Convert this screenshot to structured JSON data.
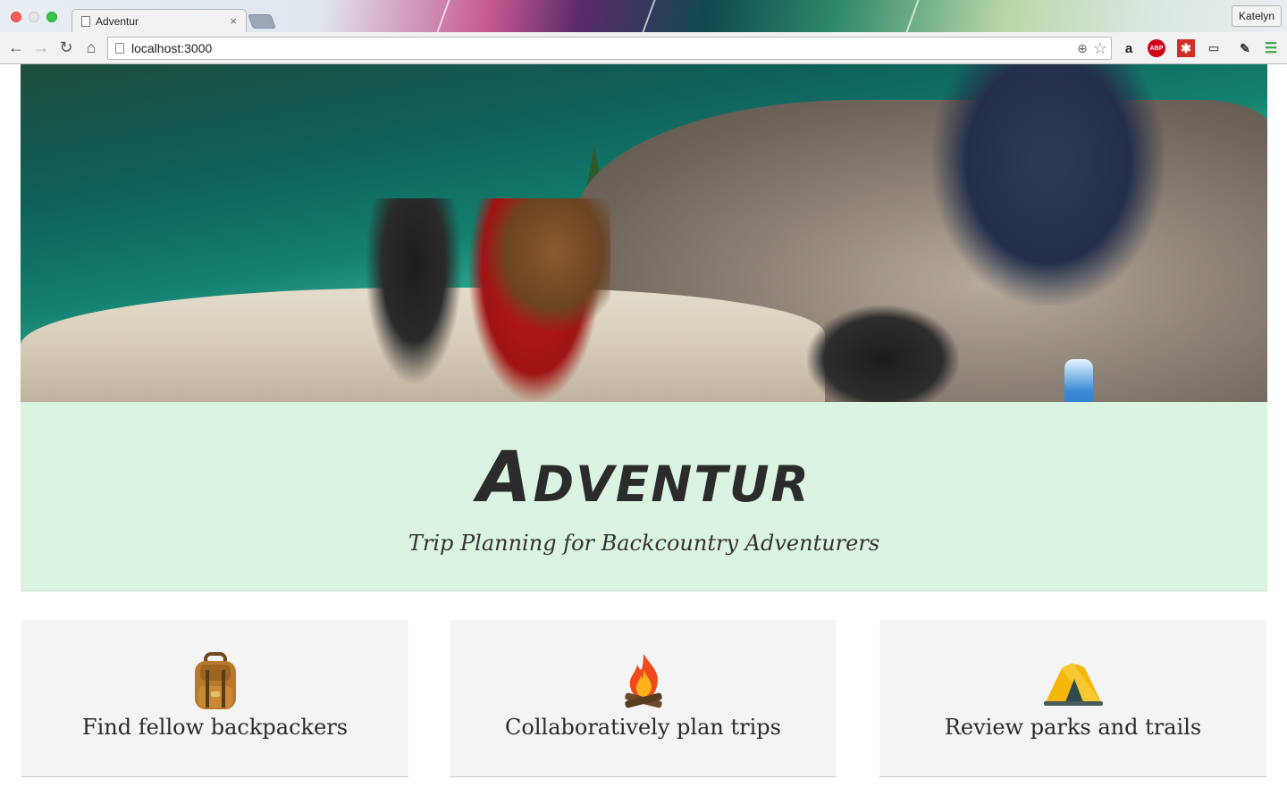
{
  "browser": {
    "tab_title": "Adventur",
    "tab_close": "×",
    "profile_name": "Katelyn",
    "url": "localhost:3000",
    "icons": [
      "back-arrow-icon",
      "forward-arrow-icon",
      "reload-icon",
      "home-icon",
      "page-icon",
      "zoom-icon",
      "star-icon",
      "amazon-icon",
      "adblock-icon",
      "lastpass-icon",
      "cast-icon",
      "eyedropper-icon",
      "menu-icon"
    ],
    "ext_labels": {
      "amazon": "a",
      "abp": "ABP",
      "lastpass": "✱"
    }
  },
  "hero": {
    "alt": "Backpackers resting on rocks above an alpine lake"
  },
  "banner": {
    "title": "Adventur",
    "tagline": "Trip Planning for Backcountry Adventurers",
    "background": "#dbf3e1"
  },
  "features": [
    {
      "icon": "backpack-icon",
      "label": "Find fellow backpackers"
    },
    {
      "icon": "campfire-icon",
      "label": "Collaboratively plan trips"
    },
    {
      "icon": "tent-icon",
      "label": "Review parks and trails"
    }
  ]
}
